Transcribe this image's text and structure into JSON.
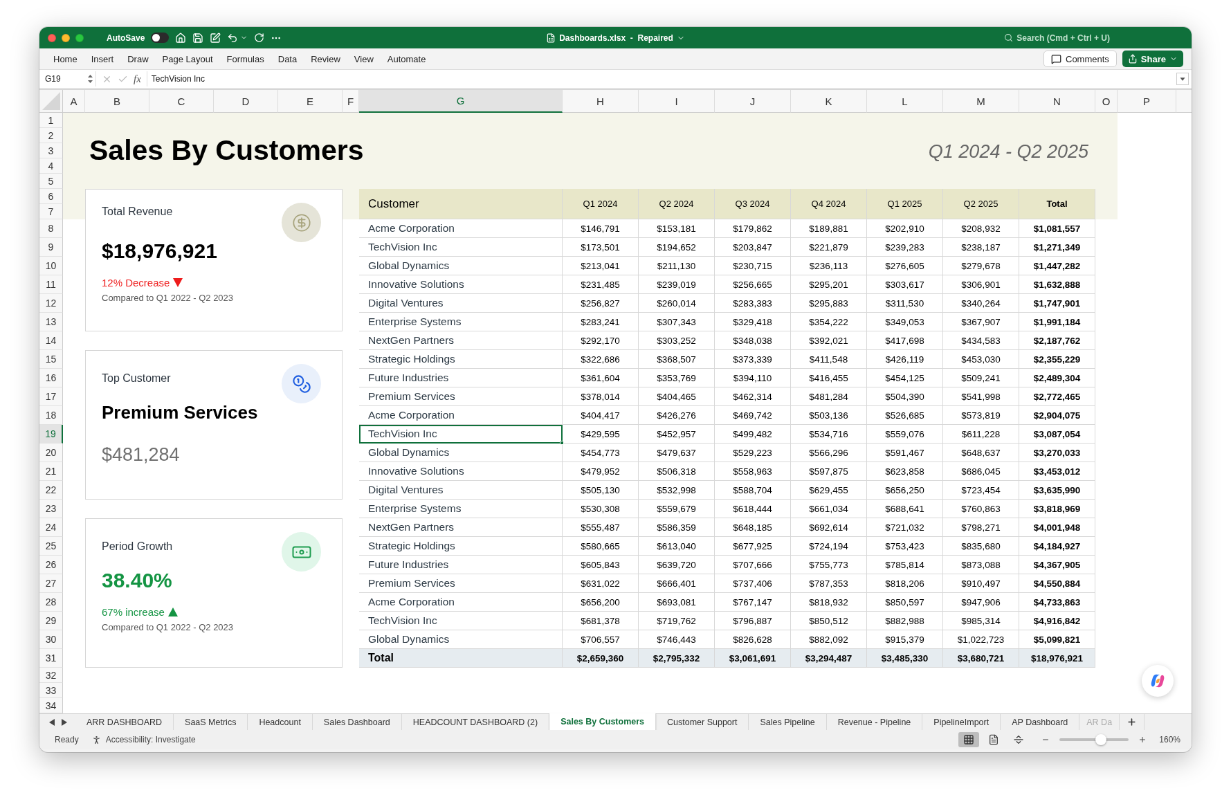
{
  "window": {
    "title": "Dashboards.xlsx  -  Repaired"
  },
  "title_bar": {
    "autosave": {
      "label": "AutoSave",
      "on": false
    },
    "search": {
      "placeholder": "Search (Cmd + Ctrl + U)"
    }
  },
  "ribbon": {
    "tabs": [
      "Home",
      "Insert",
      "Draw",
      "Page Layout",
      "Formulas",
      "Data",
      "Review",
      "View",
      "Automate"
    ],
    "comments": "Comments",
    "share": "Share"
  },
  "formula_bar": {
    "name_box": "G19",
    "function_label": "fx",
    "formula": "TechVision Inc"
  },
  "columns": [
    {
      "label": "A",
      "selected": false
    },
    {
      "label": "B",
      "selected": false
    },
    {
      "label": "C",
      "selected": false
    },
    {
      "label": "D",
      "selected": false
    },
    {
      "label": "E",
      "selected": false
    },
    {
      "label": "F",
      "selected": false
    },
    {
      "label": "G",
      "selected": true
    },
    {
      "label": "H",
      "selected": false
    },
    {
      "label": "I",
      "selected": false
    },
    {
      "label": "J",
      "selected": false
    },
    {
      "label": "K",
      "selected": false
    },
    {
      "label": "L",
      "selected": false
    },
    {
      "label": "M",
      "selected": false
    },
    {
      "label": "N",
      "selected": false
    },
    {
      "label": "O",
      "selected": false
    },
    {
      "label": "P",
      "selected": false
    }
  ],
  "rows": [
    {
      "label": "1",
      "selected": false
    },
    {
      "label": "2",
      "selected": false
    },
    {
      "label": "3",
      "selected": false
    },
    {
      "label": "4",
      "selected": false
    },
    {
      "label": "5",
      "selected": false
    },
    {
      "label": "6",
      "selected": false
    },
    {
      "label": "7",
      "selected": false
    },
    {
      "label": "8",
      "selected": false
    },
    {
      "label": "9",
      "selected": false
    },
    {
      "label": "10",
      "selected": false
    },
    {
      "label": "11",
      "selected": false
    },
    {
      "label": "12",
      "selected": false
    },
    {
      "label": "13",
      "selected": false
    },
    {
      "label": "14",
      "selected": false
    },
    {
      "label": "15",
      "selected": false
    },
    {
      "label": "16",
      "selected": false
    },
    {
      "label": "17",
      "selected": false
    },
    {
      "label": "18",
      "selected": false
    },
    {
      "label": "19",
      "selected": true
    },
    {
      "label": "20",
      "selected": false
    },
    {
      "label": "21",
      "selected": false
    },
    {
      "label": "22",
      "selected": false
    },
    {
      "label": "23",
      "selected": false
    },
    {
      "label": "24",
      "selected": false
    },
    {
      "label": "25",
      "selected": false
    },
    {
      "label": "26",
      "selected": false
    },
    {
      "label": "27",
      "selected": false
    },
    {
      "label": "28",
      "selected": false
    },
    {
      "label": "29",
      "selected": false
    },
    {
      "label": "30",
      "selected": false
    },
    {
      "label": "31",
      "selected": false
    },
    {
      "label": "32",
      "selected": false
    },
    {
      "label": "33",
      "selected": false
    },
    {
      "label": "34",
      "selected": false
    }
  ],
  "banner": {
    "title": "Sales By Customers",
    "period": "Q1 2024 - Q2 2025"
  },
  "cards": [
    {
      "kind": "revenue",
      "title": "Total Revenue",
      "value": "$18,976,921",
      "trend": {
        "text": "12% Decrease",
        "rising": false
      },
      "note": "Compared to Q1 2022 - Q2 2023"
    },
    {
      "kind": "customer",
      "title": "Top Customer",
      "value": "Premium Services",
      "amount": "$481,284"
    },
    {
      "kind": "growth",
      "title": "Period Growth",
      "value": "38.40%",
      "trend": {
        "text": "67% increase",
        "rising": true
      },
      "note": "Compared to Q1 2022 - Q2 2023"
    }
  ],
  "table": {
    "columns": [
      "Customer",
      "Q1 2024",
      "Q2 2024",
      "Q3 2024",
      "Q4 2024",
      "Q1 2025",
      "Q2 2025",
      "Total"
    ],
    "rows": [
      {
        "customer": "Acme Corporation",
        "values": [
          "$146,791",
          "$153,181",
          "$179,862",
          "$189,881",
          "$202,910",
          "$208,932"
        ],
        "total": "$1,081,557",
        "selected": false
      },
      {
        "customer": "TechVision Inc",
        "values": [
          "$173,501",
          "$194,652",
          "$203,847",
          "$221,879",
          "$239,283",
          "$238,187"
        ],
        "total": "$1,271,349",
        "selected": false
      },
      {
        "customer": "Global Dynamics",
        "values": [
          "$213,041",
          "$211,130",
          "$230,715",
          "$236,113",
          "$276,605",
          "$279,678"
        ],
        "total": "$1,447,282",
        "selected": false
      },
      {
        "customer": "Innovative Solutions",
        "values": [
          "$231,485",
          "$239,019",
          "$256,665",
          "$295,201",
          "$303,617",
          "$306,901"
        ],
        "total": "$1,632,888",
        "selected": false
      },
      {
        "customer": "Digital Ventures",
        "values": [
          "$256,827",
          "$260,014",
          "$283,383",
          "$295,883",
          "$311,530",
          "$340,264"
        ],
        "total": "$1,747,901",
        "selected": false
      },
      {
        "customer": "Enterprise Systems",
        "values": [
          "$283,241",
          "$307,343",
          "$329,418",
          "$354,222",
          "$349,053",
          "$367,907"
        ],
        "total": "$1,991,184",
        "selected": false
      },
      {
        "customer": "NextGen Partners",
        "values": [
          "$292,170",
          "$303,252",
          "$348,038",
          "$392,021",
          "$417,698",
          "$434,583"
        ],
        "total": "$2,187,762",
        "selected": false
      },
      {
        "customer": "Strategic Holdings",
        "values": [
          "$322,686",
          "$368,507",
          "$373,339",
          "$411,548",
          "$426,119",
          "$453,030"
        ],
        "total": "$2,355,229",
        "selected": false
      },
      {
        "customer": "Future Industries",
        "values": [
          "$361,604",
          "$353,769",
          "$394,110",
          "$416,455",
          "$454,125",
          "$509,241"
        ],
        "total": "$2,489,304",
        "selected": false
      },
      {
        "customer": "Premium Services",
        "values": [
          "$378,014",
          "$404,465",
          "$462,314",
          "$481,284",
          "$504,390",
          "$541,998"
        ],
        "total": "$2,772,465",
        "selected": false
      },
      {
        "customer": "Acme Corporation",
        "values": [
          "$404,417",
          "$426,276",
          "$469,742",
          "$503,136",
          "$526,685",
          "$573,819"
        ],
        "total": "$2,904,075",
        "selected": false
      },
      {
        "customer": "TechVision Inc",
        "values": [
          "$429,595",
          "$452,957",
          "$499,482",
          "$534,716",
          "$559,076",
          "$611,228"
        ],
        "total": "$3,087,054",
        "selected": true
      },
      {
        "customer": "Global Dynamics",
        "values": [
          "$454,773",
          "$479,637",
          "$529,223",
          "$566,296",
          "$591,467",
          "$648,637"
        ],
        "total": "$3,270,033",
        "selected": false
      },
      {
        "customer": "Innovative Solutions",
        "values": [
          "$479,952",
          "$506,318",
          "$558,963",
          "$597,875",
          "$623,858",
          "$686,045"
        ],
        "total": "$3,453,012",
        "selected": false
      },
      {
        "customer": "Digital Ventures",
        "values": [
          "$505,130",
          "$532,998",
          "$588,704",
          "$629,455",
          "$656,250",
          "$723,454"
        ],
        "total": "$3,635,990",
        "selected": false
      },
      {
        "customer": "Enterprise Systems",
        "values": [
          "$530,308",
          "$559,679",
          "$618,444",
          "$661,034",
          "$688,641",
          "$760,863"
        ],
        "total": "$3,818,969",
        "selected": false
      },
      {
        "customer": "NextGen Partners",
        "values": [
          "$555,487",
          "$586,359",
          "$648,185",
          "$692,614",
          "$721,032",
          "$798,271"
        ],
        "total": "$4,001,948",
        "selected": false
      },
      {
        "customer": "Strategic Holdings",
        "values": [
          "$580,665",
          "$613,040",
          "$677,925",
          "$724,194",
          "$753,423",
          "$835,680"
        ],
        "total": "$4,184,927",
        "selected": false
      },
      {
        "customer": "Future Industries",
        "values": [
          "$605,843",
          "$639,720",
          "$707,666",
          "$755,773",
          "$785,814",
          "$873,088"
        ],
        "total": "$4,367,905",
        "selected": false
      },
      {
        "customer": "Premium Services",
        "values": [
          "$631,022",
          "$666,401",
          "$737,406",
          "$787,353",
          "$818,206",
          "$910,497"
        ],
        "total": "$4,550,884",
        "selected": false
      },
      {
        "customer": "Acme Corporation",
        "values": [
          "$656,200",
          "$693,081",
          "$767,147",
          "$818,932",
          "$850,597",
          "$947,906"
        ],
        "total": "$4,733,863",
        "selected": false
      },
      {
        "customer": "TechVision Inc",
        "values": [
          "$681,378",
          "$719,762",
          "$796,887",
          "$850,512",
          "$882,988",
          "$985,314"
        ],
        "total": "$4,916,842",
        "selected": false
      },
      {
        "customer": "Global Dynamics",
        "values": [
          "$706,557",
          "$746,443",
          "$826,628",
          "$882,092",
          "$915,379",
          "$1,022,723"
        ],
        "total": "$5,099,821",
        "selected": false
      }
    ],
    "total_row": {
      "label": "Total",
      "values": [
        "$2,659,360",
        "$2,795,332",
        "$3,061,691",
        "$3,294,487",
        "$3,485,330",
        "$3,680,721"
      ],
      "total": "$18,976,921"
    }
  },
  "sheet_tabs": [
    {
      "label": "ARR DASHBOARD",
      "selected": false
    },
    {
      "label": "SaaS Metrics",
      "selected": false
    },
    {
      "label": "Headcount",
      "selected": false
    },
    {
      "label": "Sales Dashboard",
      "selected": false
    },
    {
      "label": "HEADCOUNT DASHBOARD (2)",
      "selected": false
    },
    {
      "label": "Sales By Customers",
      "selected": true
    },
    {
      "label": "Customer Support",
      "selected": false
    },
    {
      "label": "Sales Pipeline",
      "selected": false
    },
    {
      "label": "Revenue - Pipeline",
      "selected": false
    },
    {
      "label": "PipelineImport",
      "selected": false
    },
    {
      "label": "AP Dashboard",
      "selected": false
    },
    {
      "label": "AR Da",
      "selected": false
    }
  ],
  "status_bar": {
    "status": "Ready",
    "accessibility": "Accessibility: Investigate",
    "views": [
      {
        "kind": "normal",
        "selected": true
      },
      {
        "kind": "page_layout",
        "selected": false
      },
      {
        "kind": "page_break",
        "selected": false
      }
    ],
    "zoom": {
      "level": 0.6,
      "reading": "160%"
    }
  }
}
